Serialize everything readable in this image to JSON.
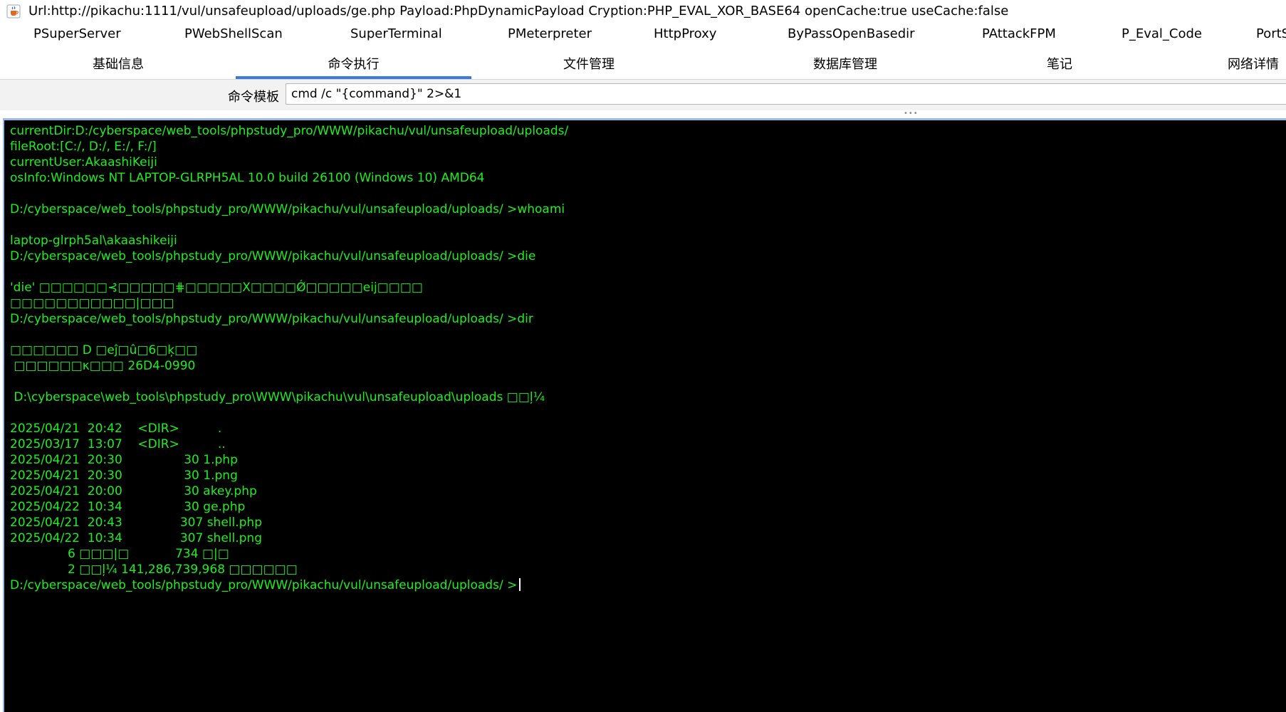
{
  "titlebar": {
    "icon": "java-cup-icon",
    "title": "Url:http://pikachu:1111/vul/unsafeupload/uploads/ge.php Payload:PhpDynamicPayload Cryption:PHP_EVAL_XOR_BASE64 openCache:true useCache:false"
  },
  "plugin_tabs": [
    "PSuperServer",
    "PWebShellScan",
    "SuperTerminal",
    "PMeterpreter",
    "HttpProxy",
    "ByPassOpenBasedir",
    "PAttackFPM",
    "P_Eval_Code",
    "PortS"
  ],
  "main_tabs": [
    {
      "label": "基础信息",
      "active": false
    },
    {
      "label": "命令执行",
      "active": true
    },
    {
      "label": "文件管理",
      "active": false
    },
    {
      "label": "数据库管理",
      "active": false
    },
    {
      "label": "笔记",
      "active": false
    },
    {
      "label": "网络详情",
      "active": false
    }
  ],
  "command_template": {
    "label": "命令模板",
    "value": "cmd /c \"{command}\" 2>&1"
  },
  "colors": {
    "terminal_bg": "#000000",
    "terminal_text": "#1cf01c",
    "active_tab_underline": "#3d7bd9"
  },
  "terminal": {
    "lines": [
      "currentDir:D:/cyberspace/web_tools/phpstudy_pro/WWW/pikachu/vul/unsafeupload/uploads/",
      "fileRoot:[C:/, D:/, E:/, F:/]",
      "currentUser:AkaashiKeiji",
      "osInfo:Windows NT LAPTOP-GLRPH5AL 10.0 build 26100 (Windows 10) AMD64",
      "",
      "D:/cyberspace/web_tools/phpstudy_pro/WWW/pikachu/vul/unsafeupload/uploads/ >whoami",
      "",
      "laptop-glrph5al\\akaashikeiji",
      "D:/cyberspace/web_tools/phpstudy_pro/WWW/pikachu/vul/unsafeupload/uploads/ >die",
      "",
      "'die' □□□□□□⊰□□□□□⋕□□□□□X□□□□Ǿ□□□□□eij□□□□",
      "□□□□□□□□□□□|□□□",
      "D:/cyberspace/web_tools/phpstudy_pro/WWW/pikachu/vul/unsafeupload/uploads/ >dir",
      "",
      "□□□□□□ D □eĵ□û□6□ķ□□",
      " □□□□□□κ□□□ 26D4-0990",
      "",
      " D:\\cyberspace\\web_tools\\phpstudy_pro\\WWW\\pikachu\\vul\\unsafeupload\\uploads □□ļ¼",
      "",
      "2025/04/21  20:42    <DIR>          .",
      "2025/03/17  13:07    <DIR>          ..",
      "2025/04/21  20:30                30 1.php",
      "2025/04/21  20:30                30 1.png",
      "2025/04/21  20:00                30 akey.php",
      "2025/04/22  10:34                30 ge.php",
      "2025/04/21  20:43               307 shell.php",
      "2025/04/22  10:34               307 shell.png",
      "               6 □□□|□            734 □|□",
      "               2 □□ļ¼ 141,286,739,968 □□□□□□",
      "D:/cyberspace/web_tools/phpstudy_pro/WWW/pikachu/vul/unsafeupload/uploads/ >"
    ]
  }
}
